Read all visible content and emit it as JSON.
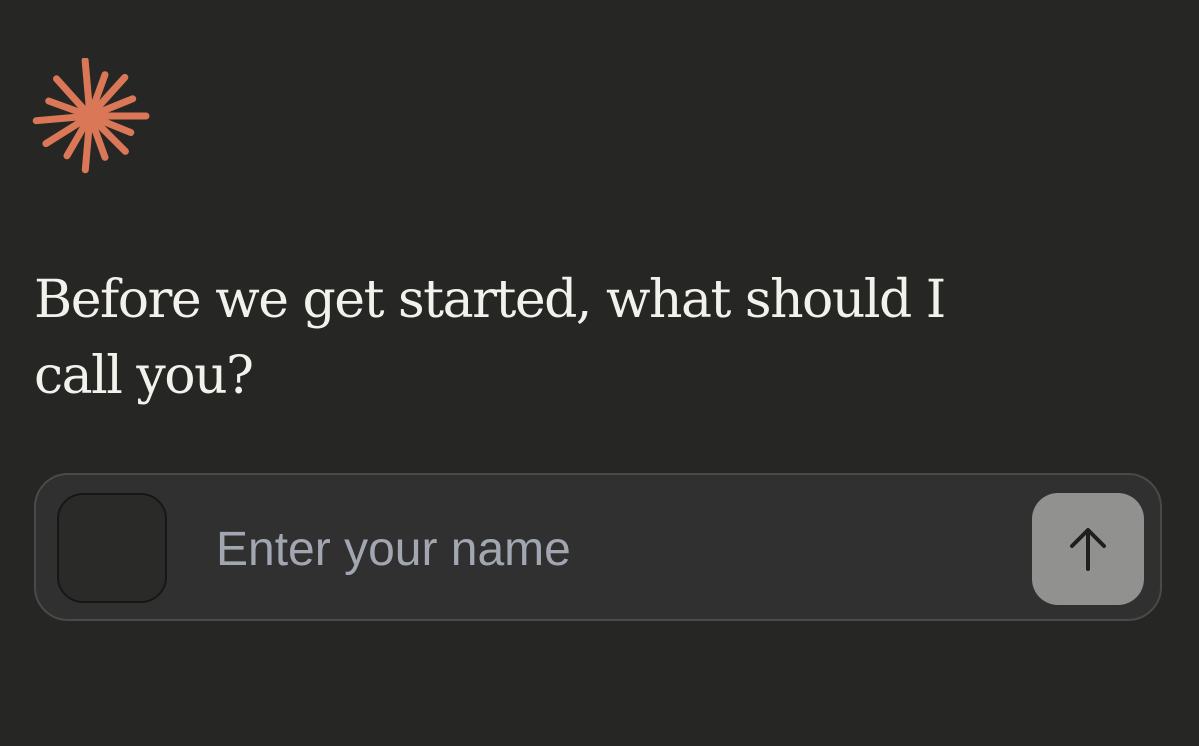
{
  "brand": {
    "logo_icon": "sunburst-asterisk-icon",
    "accent_color": "#d97757"
  },
  "prompt": {
    "question": "Before we get started, what should I call you?"
  },
  "name_input": {
    "placeholder": "Enter your name",
    "value": ""
  },
  "send_button": {
    "icon": "arrow-up-icon",
    "aria_label": "Submit"
  },
  "colors": {
    "background": "#262625",
    "input_background": "#303030",
    "send_button_background": "#919190",
    "placeholder_text": "#a2a6b1",
    "heading_text": "#f3f1ec"
  }
}
